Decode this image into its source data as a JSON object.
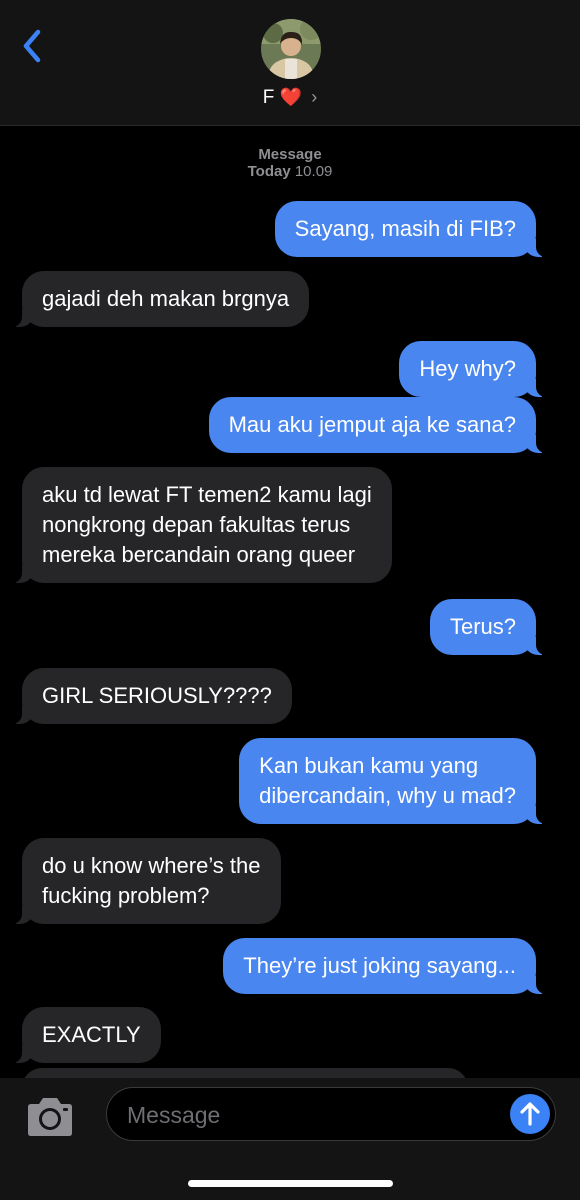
{
  "header": {
    "contact_name": "F",
    "contact_heart": "❤️",
    "chevron": "›"
  },
  "meta": {
    "service": "Message",
    "day": "Today",
    "time": "10.09"
  },
  "messages": [
    {
      "side": "out",
      "text": "Sayang, masih di FIB?"
    },
    {
      "side": "in",
      "text": "gajadi deh makan brgnya"
    },
    {
      "side": "out",
      "text": "Hey why?"
    },
    {
      "side": "out",
      "text": "Mau aku jemput aja ke sana?"
    },
    {
      "side": "in",
      "lines": [
        "aku td lewat FT temen2 kamu lagi",
        "nongkrong depan fakultas terus",
        "mereka bercandain orang queer"
      ]
    },
    {
      "side": "out",
      "text": "Terus?"
    },
    {
      "side": "in",
      "text": "GIRL SERIOUSLY????"
    },
    {
      "side": "out",
      "lines": [
        "Kan bukan kamu yang",
        "dibercandain, why u mad?"
      ]
    },
    {
      "side": "in",
      "lines": [
        "do u know where’s the",
        "fucking problem?"
      ]
    },
    {
      "side": "out",
      "text": "They’re just joking sayang..."
    },
    {
      "side": "in",
      "text": "EXACTLY"
    }
  ],
  "composer": {
    "placeholder": "Message"
  },
  "colors": {
    "outgoing_bubble": "#4a86ef",
    "incoming_bubble": "#262628",
    "accent": "#3b82f6"
  },
  "icons": {
    "back": "chevron-left-icon",
    "camera": "camera-icon",
    "send": "arrow-up-icon"
  }
}
